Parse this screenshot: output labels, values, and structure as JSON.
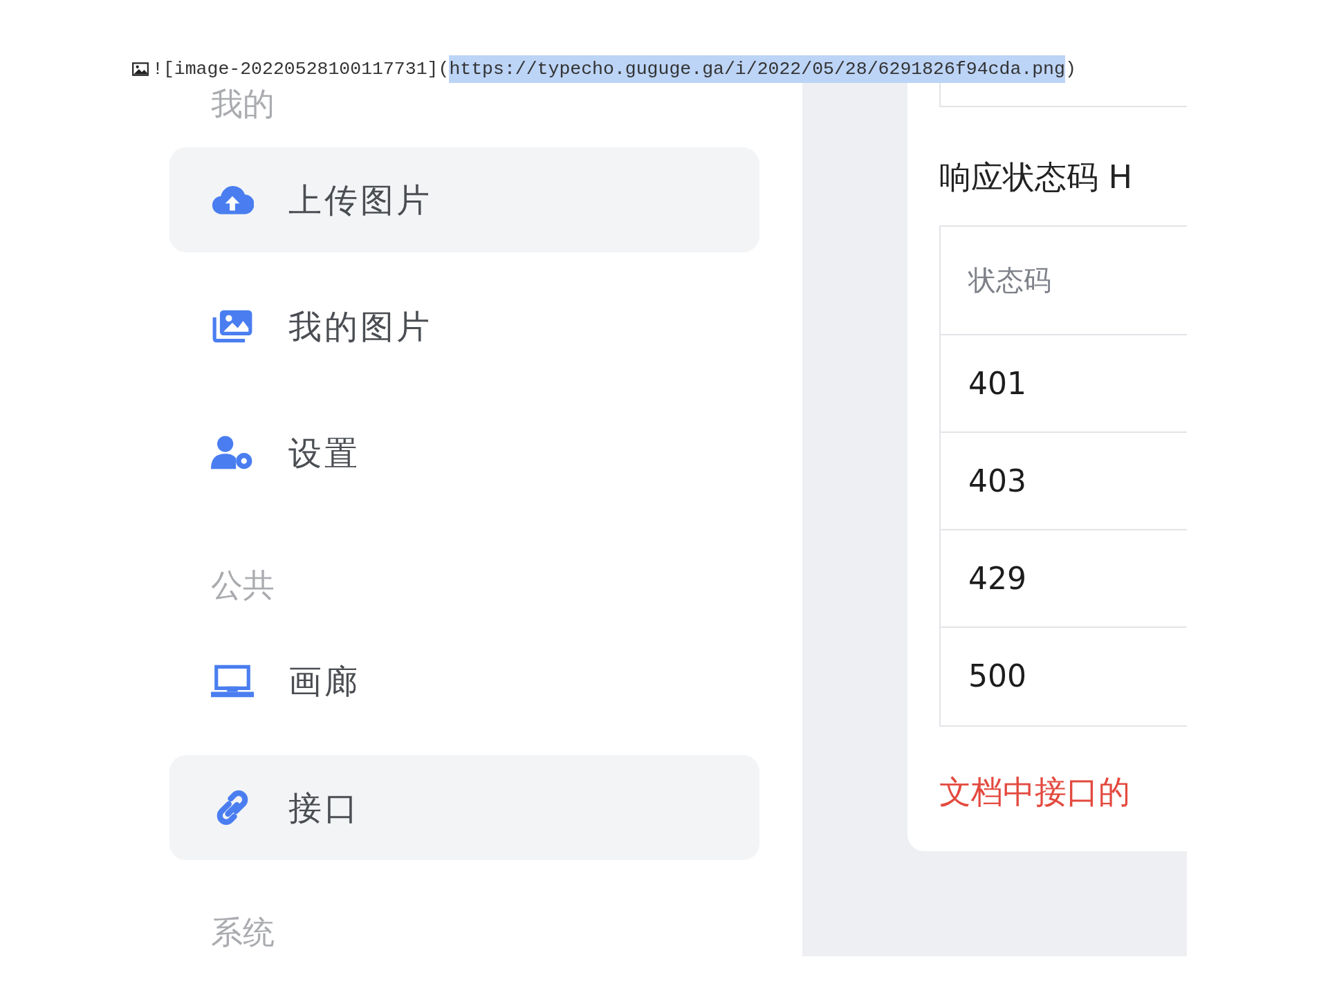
{
  "editor_line": {
    "prefix": "![image-20220528100117731](",
    "url": "https://typecho.guguge.ga/i/2022/05/28/6291826f94cda.png",
    "url_selected": true,
    "suffix": ")"
  },
  "sidebar": {
    "sections": [
      {
        "title": "我的",
        "items": [
          {
            "label": "上传图片",
            "kind": "upload",
            "selected": true
          },
          {
            "label": "我的图片",
            "kind": "images",
            "selected": false
          },
          {
            "label": "设置",
            "kind": "settings",
            "selected": false
          }
        ]
      },
      {
        "title": "公共",
        "items": [
          {
            "label": "画廊",
            "kind": "gallery",
            "selected": false
          },
          {
            "label": "接口",
            "kind": "api",
            "selected": true
          }
        ]
      },
      {
        "title": "系统"
      }
    ]
  },
  "content": {
    "heading": "响应状态码 H",
    "table": {
      "columns": [
        "状态码"
      ],
      "rows": [
        "401",
        "403",
        "429",
        "500"
      ]
    },
    "note": "文档中接口的"
  }
}
